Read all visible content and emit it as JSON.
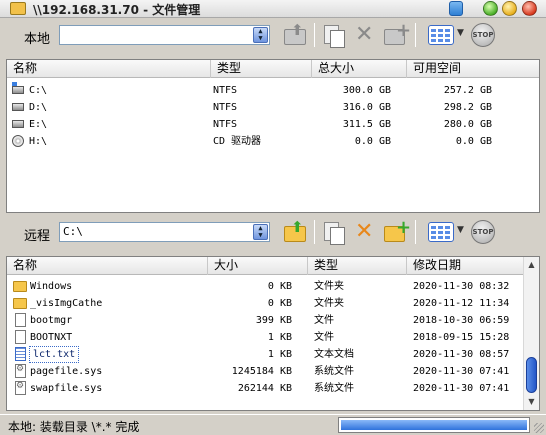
{
  "window": {
    "title": "\\\\192.168.31.70 - 文件管理"
  },
  "local": {
    "label": "本地",
    "path": "",
    "columns": [
      "名称",
      "类型",
      "总大小",
      "可用空间"
    ],
    "rows": [
      {
        "icon": "system-drive-icon",
        "name": "C:\\",
        "type": "NTFS",
        "total": "300.0 GB",
        "free": "257.2 GB"
      },
      {
        "icon": "drive-icon",
        "name": "D:\\",
        "type": "NTFS",
        "total": "316.0 GB",
        "free": "298.2 GB"
      },
      {
        "icon": "drive-icon",
        "name": "E:\\",
        "type": "NTFS",
        "total": "311.5 GB",
        "free": "280.0 GB"
      },
      {
        "icon": "cd-drive-icon",
        "name": "H:\\",
        "type": "CD 驱动器",
        "total": "0.0 GB",
        "free": "0.0 GB"
      }
    ]
  },
  "remote": {
    "label": "远程",
    "path": "C:\\",
    "columns": [
      "名称",
      "大小",
      "类型",
      "修改日期"
    ],
    "rows": [
      {
        "icon": "folder-icon",
        "name": "Windows",
        "size": "0 KB",
        "type": "文件夹",
        "date": "2020-11-30 08:32"
      },
      {
        "icon": "folder-icon",
        "name": "_visImgCathe",
        "size": "0 KB",
        "type": "文件夹",
        "date": "2020-11-12 11:34"
      },
      {
        "icon": "file-icon",
        "name": "bootmgr",
        "size": "399 KB",
        "type": "文件",
        "date": "2018-10-30 06:59"
      },
      {
        "icon": "file-icon",
        "name": "BOOTNXT",
        "size": "1 KB",
        "type": "文件",
        "date": "2018-09-15 15:28"
      },
      {
        "icon": "text-file-icon",
        "name": "lct.txt",
        "size": "1 KB",
        "type": "文本文档",
        "date": "2020-11-30 08:57",
        "selected": true
      },
      {
        "icon": "system-file-icon",
        "name": "pagefile.sys",
        "size": "1245184 KB",
        "type": "系统文件",
        "date": "2020-11-30 07:41"
      },
      {
        "icon": "system-file-icon",
        "name": "swapfile.sys",
        "size": "262144 KB",
        "type": "系统文件",
        "date": "2020-11-30 07:41"
      }
    ]
  },
  "toolbar_icons": [
    "folder-up-icon",
    "copy-icon",
    "delete-icon",
    "new-folder-icon",
    "view-mode-icon",
    "stop-icon"
  ],
  "status": {
    "text": "本地: 装载目录 \\*.* 完成",
    "progress": 1.0
  },
  "colors": {
    "accent": "#2f72dc",
    "folder": "#f6c64a",
    "delete_active": "#e8871a"
  }
}
